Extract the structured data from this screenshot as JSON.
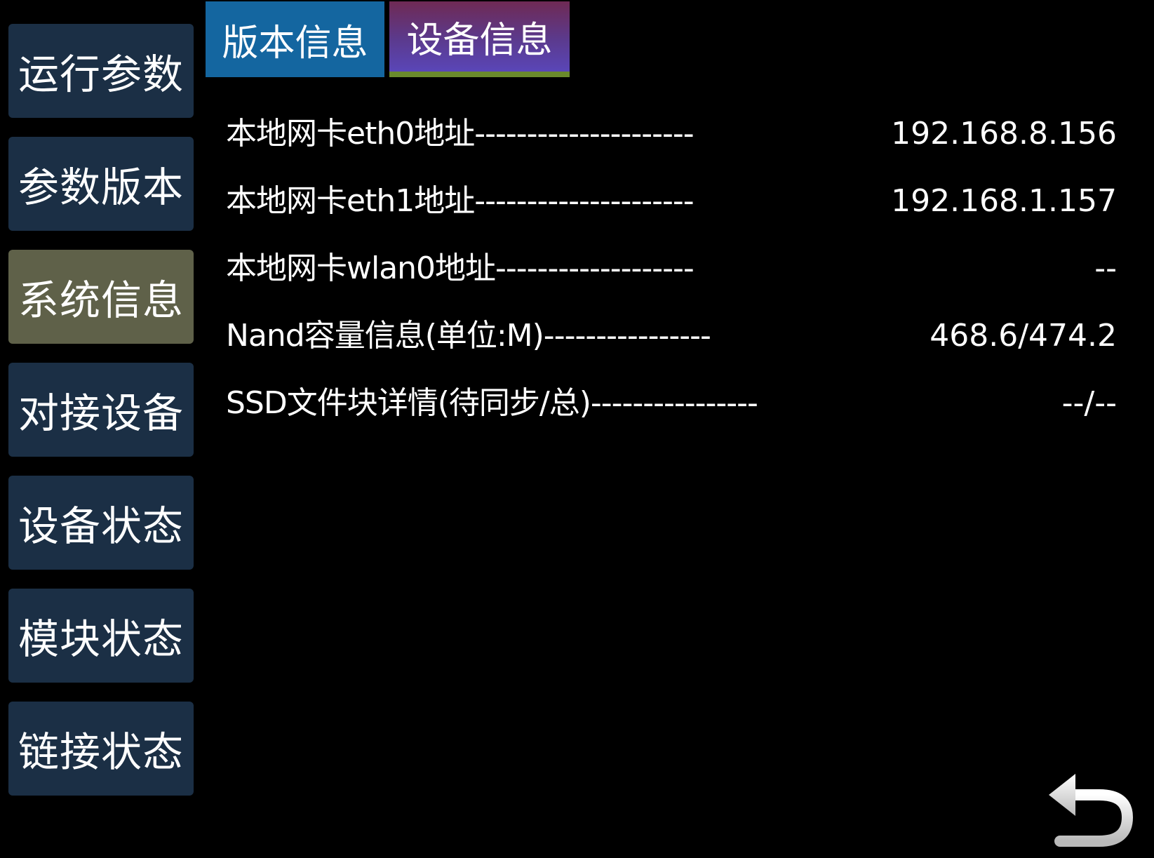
{
  "sidebar": {
    "items": [
      {
        "label": "运行参数",
        "active": false
      },
      {
        "label": "参数版本",
        "active": false
      },
      {
        "label": "系统信息",
        "active": true
      },
      {
        "label": "对接设备",
        "active": false
      },
      {
        "label": "设备状态",
        "active": false
      },
      {
        "label": "模块状态",
        "active": false
      },
      {
        "label": "链接状态",
        "active": false
      }
    ]
  },
  "tabs": [
    {
      "label": "版本信息",
      "selected": false
    },
    {
      "label": "设备信息",
      "selected": true
    }
  ],
  "info": {
    "rows": [
      {
        "label": "本地网卡eth0地址---------------------",
        "value": "192.168.8.156"
      },
      {
        "label": "本地网卡eth1地址---------------------",
        "value": "192.168.1.157"
      },
      {
        "label": "本地网卡wlan0地址-------------------",
        "value": "--"
      },
      {
        "label": "Nand容量信息(单位:M)----------------",
        "value": "468.6/474.2"
      },
      {
        "label": "SSD文件块详情(待同步/总)----------------",
        "value": "--/--"
      }
    ]
  },
  "back_button": {
    "icon": "back-arrow-icon"
  },
  "colors": {
    "background": "#000000",
    "sidebar_button": "#1b2f45",
    "sidebar_active": "#5f6149",
    "tab_version": "#1466a0",
    "tab_device_gradient_top": "#6f2a54",
    "tab_device_gradient_bottom": "#5a46b8",
    "tab_underline": "#6a8a2c",
    "text": "#ffffff"
  }
}
